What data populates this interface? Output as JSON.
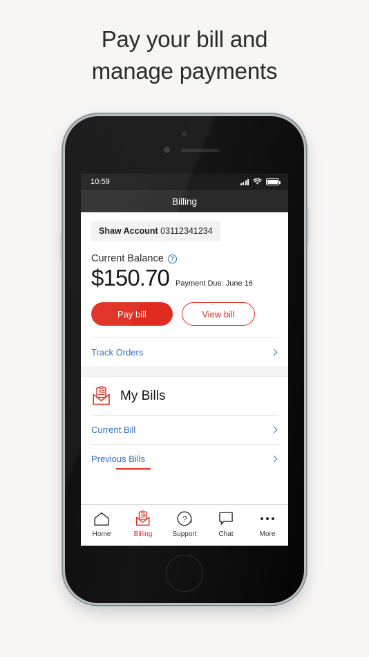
{
  "headline": {
    "line1": "Pay your bill and",
    "line2": "manage payments"
  },
  "colors": {
    "brand_red": "#E02B20",
    "link_blue": "#2F6FBE",
    "page_background": "#F7F6F5",
    "chip_background": "#F2F2F2",
    "status_bar": "#1C1C1C"
  },
  "phone": {
    "status_bar": {
      "time": "10:59",
      "icons": [
        "signal-bars-icon",
        "wifi-icon",
        "battery-icon"
      ]
    },
    "navbar": {
      "title": "Billing"
    }
  },
  "app": {
    "account": {
      "label": "Shaw Account",
      "number": "03112341234"
    },
    "balance": {
      "label": "Current Balance",
      "help_icon": "help-circle-icon",
      "amount": "$150.70",
      "due_text": "Payment Due: June 16"
    },
    "actions": {
      "pay_bill": "Pay bill",
      "view_bill": "View bill"
    },
    "track_orders": {
      "label": "Track Orders",
      "chevron": "chevron-right-icon"
    },
    "my_bills": {
      "icon": "bill-envelope-icon",
      "title": "My Bills",
      "rows": [
        {
          "label": "Current Bill",
          "chevron": "chevron-right-icon"
        },
        {
          "label": "Previous Bills",
          "chevron": "chevron-right-icon"
        }
      ]
    },
    "tabbar": [
      {
        "label": "Home",
        "icon": "home-icon",
        "active": false
      },
      {
        "label": "Billing",
        "icon": "bill-envelope-icon",
        "active": true
      },
      {
        "label": "Support",
        "icon": "question-circle-icon",
        "active": false
      },
      {
        "label": "Chat",
        "icon": "chat-bubble-icon",
        "active": false
      },
      {
        "label": "More",
        "icon": "ellipsis-icon",
        "active": false
      }
    ]
  }
}
